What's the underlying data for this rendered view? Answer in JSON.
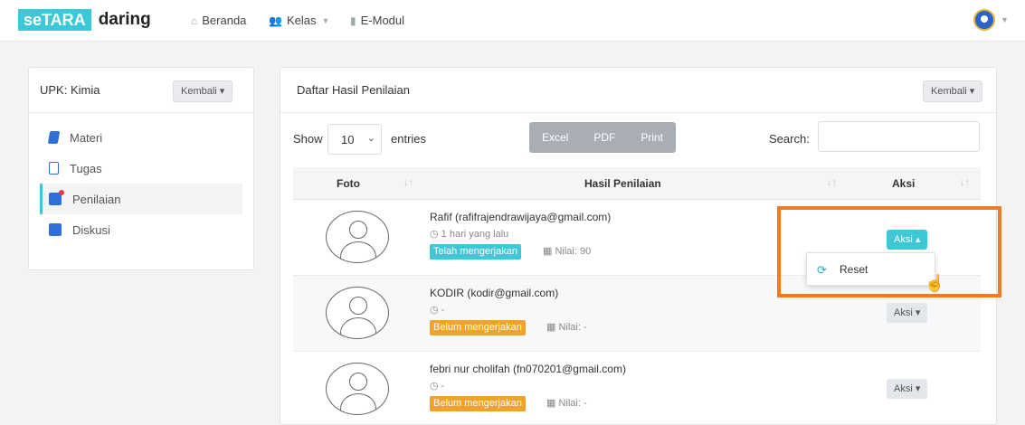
{
  "navbar": {
    "logo_part1": "seTARA",
    "logo_part2": "daring",
    "items": [
      {
        "label": "Beranda",
        "icon": "home-icon"
      },
      {
        "label": "Kelas",
        "icon": "users-icon"
      },
      {
        "label": "E-Modul",
        "icon": "book-icon"
      }
    ]
  },
  "sidebar": {
    "title": "UPK: Kimia",
    "back_label": "Kembali",
    "items": [
      {
        "label": "Materi",
        "icon": "book-icon"
      },
      {
        "label": "Tugas",
        "icon": "file-icon"
      },
      {
        "label": "Penilaian",
        "icon": "grade-icon",
        "active": true
      },
      {
        "label": "Diskusi",
        "icon": "chat-icon"
      }
    ]
  },
  "main": {
    "title": "Daftar Hasil Penilaian",
    "back_label": "Kembali",
    "show_label": "Show",
    "entries_value": "10",
    "entries_label": "entries",
    "export_buttons": [
      "Excel",
      "PDF",
      "Print"
    ],
    "search_label": "Search:",
    "columns": [
      "Foto",
      "Hasil Penilaian",
      "Aksi"
    ],
    "rows": [
      {
        "name": "Rafif (rafifrajendrawijaya@gmail.com)",
        "time": "1 hari yang lalu",
        "status": "Telah mengerjakan",
        "nilai": "Nilai: 90",
        "aksi": "Aksi"
      },
      {
        "name": "KODIR (kodir@gmail.com)",
        "time": "-",
        "status": "Belum mengerjakan",
        "nilai": "Nilai: -",
        "aksi": "Aksi"
      },
      {
        "name": "febri nur cholifah (fn070201@gmail.com)",
        "time": "-",
        "status": "Belum mengerjakan",
        "nilai": "Nilai: -",
        "aksi": "Aksi"
      }
    ],
    "dropdown": {
      "label": "Reset",
      "icon": "refresh-icon"
    }
  },
  "colors": {
    "accent": "#3ec7d6",
    "warning": "#f0a22c",
    "highlight": "#f27a24"
  }
}
